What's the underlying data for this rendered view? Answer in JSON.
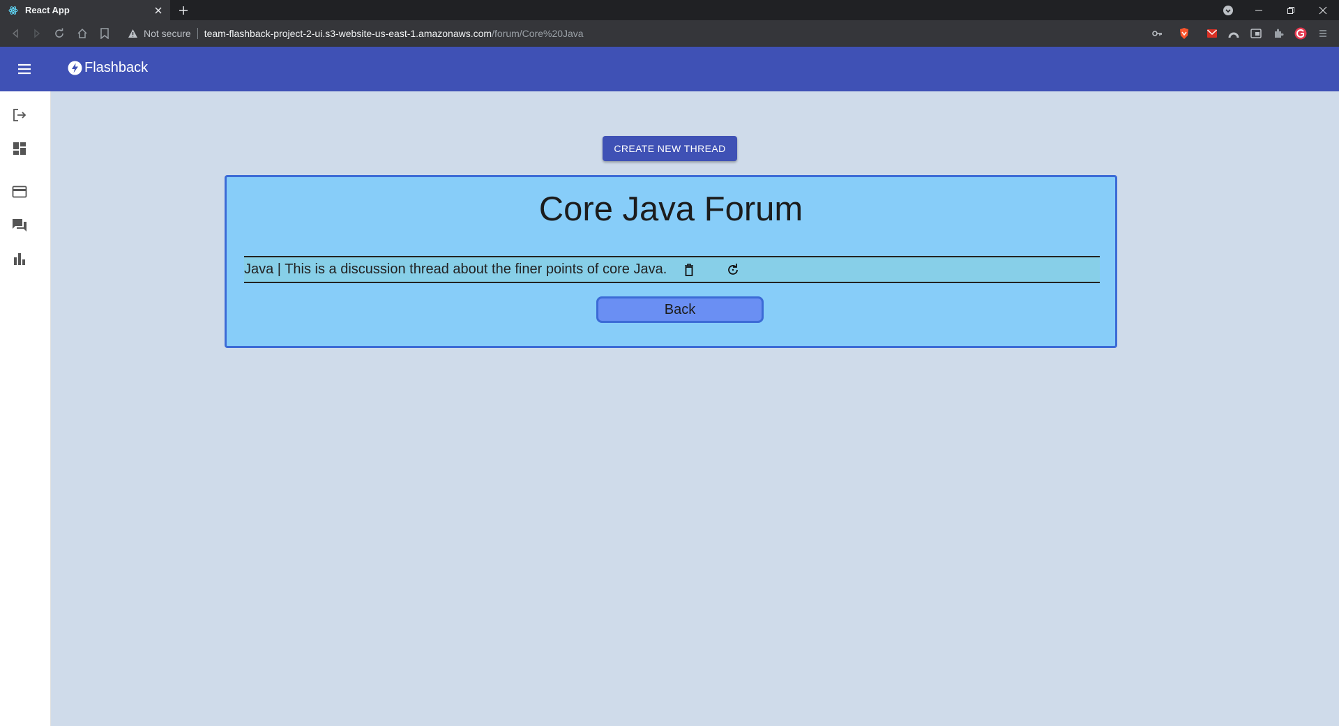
{
  "browser": {
    "tab_title": "React App",
    "address": {
      "security_label": "Not secure",
      "host": "team-flashback-project-2-ui.s3-website-us-east-1.amazonaws.com",
      "path": "/forum/Core%20Java"
    }
  },
  "app": {
    "brand": "Flashback",
    "sidebar_items": [
      "logout-icon",
      "dashboard-icon",
      "card-icon",
      "forum-icon",
      "chart-icon"
    ],
    "create_button": "CREATE NEW THREAD",
    "forum_title": "Core Java Forum",
    "threads": [
      {
        "text": "Java | This is a discussion thread about the finer points of core Java."
      }
    ],
    "back_button": "Back"
  },
  "colors": {
    "appbar": "#3f51b5",
    "main_bg": "#cfdbea",
    "card_bg": "#87cdf9",
    "card_border": "#3c6bd6",
    "back_button_bg": "#6a8ff3"
  }
}
